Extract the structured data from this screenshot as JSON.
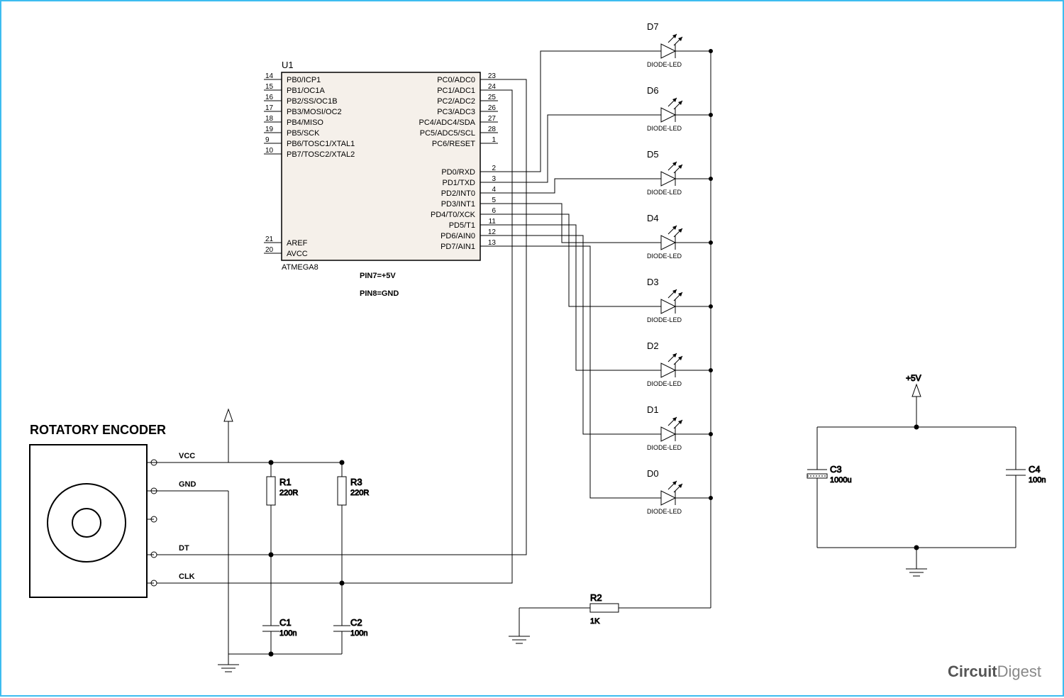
{
  "ic": {
    "ref": "U1",
    "part": "ATMEGA8",
    "note1": "PIN7=+5V",
    "note2": "PIN8=GND",
    "left_pins": [
      {
        "num": "14",
        "label": "PB0/ICP1"
      },
      {
        "num": "15",
        "label": "PB1/OC1A"
      },
      {
        "num": "16",
        "label": "PB2/SS/OC1B"
      },
      {
        "num": "17",
        "label": "PB3/MOSI/OC2"
      },
      {
        "num": "18",
        "label": "PB4/MISO"
      },
      {
        "num": "19",
        "label": "PB5/SCK"
      },
      {
        "num": "9",
        "label": "PB6/TOSC1/XTAL1"
      },
      {
        "num": "10",
        "label": "PB7/TOSC2/XTAL2"
      }
    ],
    "left_pins2": [
      {
        "num": "21",
        "label": "AREF"
      },
      {
        "num": "20",
        "label": "AVCC"
      }
    ],
    "right_pins1": [
      {
        "num": "23",
        "label": "PC0/ADC0"
      },
      {
        "num": "24",
        "label": "PC1/ADC1"
      },
      {
        "num": "25",
        "label": "PC2/ADC2"
      },
      {
        "num": "26",
        "label": "PC3/ADC3"
      },
      {
        "num": "27",
        "label": "PC4/ADC4/SDA"
      },
      {
        "num": "28",
        "label": "PC5/ADC5/SCL"
      },
      {
        "num": "1",
        "label": "PC6/RESET"
      }
    ],
    "right_pins2": [
      {
        "num": "2",
        "label": "PD0/RXD"
      },
      {
        "num": "3",
        "label": "PD1/TXD"
      },
      {
        "num": "4",
        "label": "PD2/INT0"
      },
      {
        "num": "5",
        "label": "PD3/INT1"
      },
      {
        "num": "6",
        "label": "PD4/T0/XCK"
      },
      {
        "num": "11",
        "label": "PD5/T1"
      },
      {
        "num": "12",
        "label": "PD6/AIN0"
      },
      {
        "num": "13",
        "label": "PD7/AIN1"
      }
    ]
  },
  "leds": [
    {
      "ref": "D7",
      "type": "DIODE-LED"
    },
    {
      "ref": "D6",
      "type": "DIODE-LED"
    },
    {
      "ref": "D5",
      "type": "DIODE-LED"
    },
    {
      "ref": "D4",
      "type": "DIODE-LED"
    },
    {
      "ref": "D3",
      "type": "DIODE-LED"
    },
    {
      "ref": "D2",
      "type": "DIODE-LED"
    },
    {
      "ref": "D1",
      "type": "DIODE-LED"
    },
    {
      "ref": "D0",
      "type": "DIODE-LED"
    }
  ],
  "encoder": {
    "title": "ROTATORY ENCODER",
    "pins": [
      "VCC",
      "GND",
      "",
      "DT",
      "CLK"
    ]
  },
  "R1": {
    "ref": "R1",
    "val": "220R"
  },
  "R3": {
    "ref": "R3",
    "val": "220R"
  },
  "R2": {
    "ref": "R2",
    "val": "1K"
  },
  "C1": {
    "ref": "C1",
    "val": "100n"
  },
  "C2": {
    "ref": "C2",
    "val": "100n"
  },
  "C3": {
    "ref": "C3",
    "val": "1000u"
  },
  "C4": {
    "ref": "C4",
    "val": "100n"
  },
  "pwr": {
    "v5": "+5V"
  },
  "watermark": {
    "t1": "Circuit",
    "t2": "Digest"
  }
}
